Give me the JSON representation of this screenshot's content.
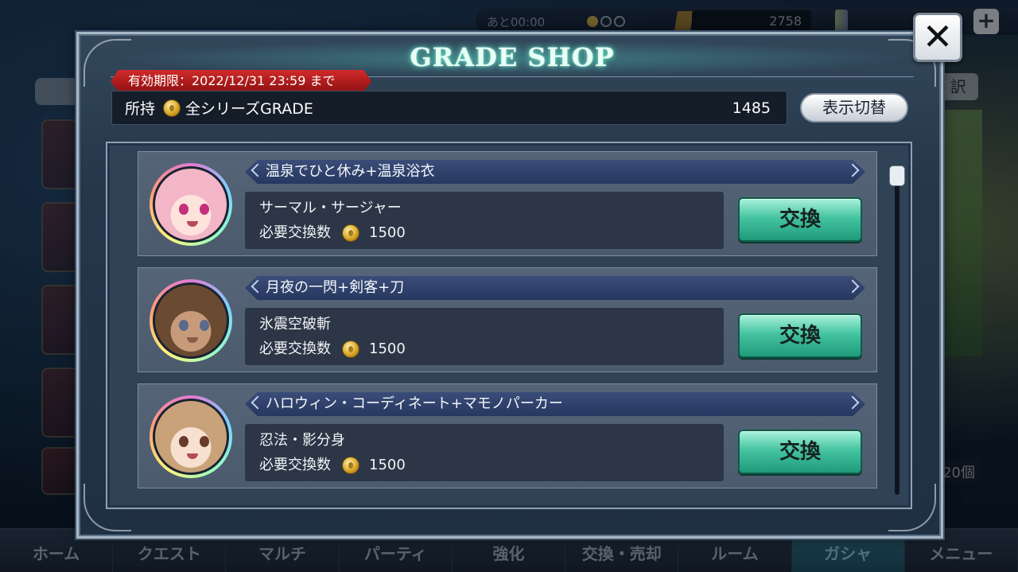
{
  "background": {
    "timer": "あと00:00",
    "currency_amount": "2758",
    "right_label": "訳",
    "right_count": "20個",
    "nav": [
      "ホーム",
      "クエスト",
      "マルチ",
      "パーティ",
      "強化",
      "交換・売却",
      "ルーム",
      "ガシャ",
      "メニュー"
    ],
    "active_nav_index": 7
  },
  "shop": {
    "title": "GRADE SHOP",
    "close_icon": "close-icon",
    "expiry": "有効期限：2022/12/31 23:59 まで",
    "holdings_label": "所持",
    "holdings_series": "全シリーズGRADE",
    "holdings_amount": "1485",
    "toggle_label": "表示切替",
    "required_label": "必要交換数",
    "exchange_label": "交換",
    "items": [
      {
        "title": "温泉でひと休み+温泉浴衣",
        "name": "サーマル・サージャー",
        "cost": "1500",
        "avatar": "pink-hair-girl-avatar",
        "hair_color": "#f2b6c8",
        "skin_color": "#fde3dc"
      },
      {
        "title": "月夜の一閃+剣客+刀",
        "name": "氷震空破斬",
        "cost": "1500",
        "avatar": "brown-hair-swordsman-avatar",
        "hair_color": "#6b4a32",
        "skin_color": "#c79b7a"
      },
      {
        "title": "ハロウィン・コーディネート+マモノパーカー",
        "name": "忍法・影分身",
        "cost": "1500",
        "avatar": "light-brown-hair-girl-avatar",
        "hair_color": "#c9a27a",
        "skin_color": "#f7e0cf"
      }
    ]
  }
}
